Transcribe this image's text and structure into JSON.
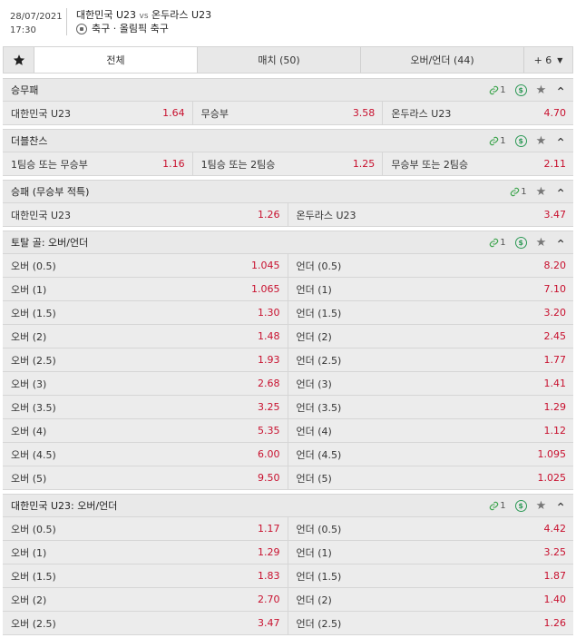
{
  "header": {
    "date": "28/07/2021",
    "time": "17:30",
    "home": "대한민국 U23",
    "vs": "vs",
    "away": "온두라스 U23",
    "competition": "축구 · 올림픽 축구"
  },
  "tabs": {
    "all": "전체",
    "match": "매치 (50)",
    "over_under": "오버/언더 (44)",
    "more": "+ 6"
  },
  "sections": [
    {
      "title": "승무패",
      "link_count": "1",
      "has_dollar": true,
      "rows": [
        [
          {
            "label": "대한민국 U23",
            "odd": "1.64"
          },
          {
            "label": "무승부",
            "odd": "3.58"
          },
          {
            "label": "온두라스 U23",
            "odd": "4.70"
          }
        ]
      ]
    },
    {
      "title": "더블찬스",
      "link_count": "1",
      "has_dollar": true,
      "rows": [
        [
          {
            "label": "1팀승 또는 무승부",
            "odd": "1.16"
          },
          {
            "label": "1팀승 또는 2팀승",
            "odd": "1.25"
          },
          {
            "label": "무승부 또는 2팀승",
            "odd": "2.11"
          }
        ]
      ]
    },
    {
      "title": "승패 (무승부 적특)",
      "link_count": "1",
      "has_dollar": false,
      "rows": [
        [
          {
            "label": "대한민국 U23",
            "odd": "1.26"
          },
          {
            "label": "온두라스 U23",
            "odd": "3.47"
          }
        ]
      ]
    },
    {
      "title": "토탈 골: 오버/언더",
      "link_count": "1",
      "has_dollar": true,
      "rows": [
        [
          {
            "label": "오버 (0.5)",
            "odd": "1.045"
          },
          {
            "label": "언더 (0.5)",
            "odd": "8.20"
          }
        ],
        [
          {
            "label": "오버 (1)",
            "odd": "1.065"
          },
          {
            "label": "언더 (1)",
            "odd": "7.10"
          }
        ],
        [
          {
            "label": "오버 (1.5)",
            "odd": "1.30"
          },
          {
            "label": "언더 (1.5)",
            "odd": "3.20"
          }
        ],
        [
          {
            "label": "오버 (2)",
            "odd": "1.48"
          },
          {
            "label": "언더 (2)",
            "odd": "2.45"
          }
        ],
        [
          {
            "label": "오버 (2.5)",
            "odd": "1.93"
          },
          {
            "label": "언더 (2.5)",
            "odd": "1.77"
          }
        ],
        [
          {
            "label": "오버 (3)",
            "odd": "2.68"
          },
          {
            "label": "언더 (3)",
            "odd": "1.41"
          }
        ],
        [
          {
            "label": "오버 (3.5)",
            "odd": "3.25"
          },
          {
            "label": "언더 (3.5)",
            "odd": "1.29"
          }
        ],
        [
          {
            "label": "오버 (4)",
            "odd": "5.35"
          },
          {
            "label": "언더 (4)",
            "odd": "1.12"
          }
        ],
        [
          {
            "label": "오버 (4.5)",
            "odd": "6.00"
          },
          {
            "label": "언더 (4.5)",
            "odd": "1.095"
          }
        ],
        [
          {
            "label": "오버 (5)",
            "odd": "9.50"
          },
          {
            "label": "언더 (5)",
            "odd": "1.025"
          }
        ]
      ]
    },
    {
      "title": "대한민국 U23: 오버/언더",
      "link_count": "1",
      "has_dollar": true,
      "rows": [
        [
          {
            "label": "오버 (0.5)",
            "odd": "1.17"
          },
          {
            "label": "언더 (0.5)",
            "odd": "4.42"
          }
        ],
        [
          {
            "label": "오버 (1)",
            "odd": "1.29"
          },
          {
            "label": "언더 (1)",
            "odd": "3.25"
          }
        ],
        [
          {
            "label": "오버 (1.5)",
            "odd": "1.83"
          },
          {
            "label": "언더 (1.5)",
            "odd": "1.87"
          }
        ],
        [
          {
            "label": "오버 (2)",
            "odd": "2.70"
          },
          {
            "label": "언더 (2)",
            "odd": "1.40"
          }
        ],
        [
          {
            "label": "오버 (2.5)",
            "odd": "3.47"
          },
          {
            "label": "언더 (2.5)",
            "odd": "1.26"
          }
        ]
      ]
    }
  ],
  "icons": {
    "link": "link-icon",
    "dollar": "dollar-circle-icon",
    "star": "star-icon",
    "collapse": "chevron-up-icon",
    "sport": "soccer-ball-icon"
  },
  "colors": {
    "odd": "#c8102e",
    "accent_green": "#2e9a57"
  }
}
